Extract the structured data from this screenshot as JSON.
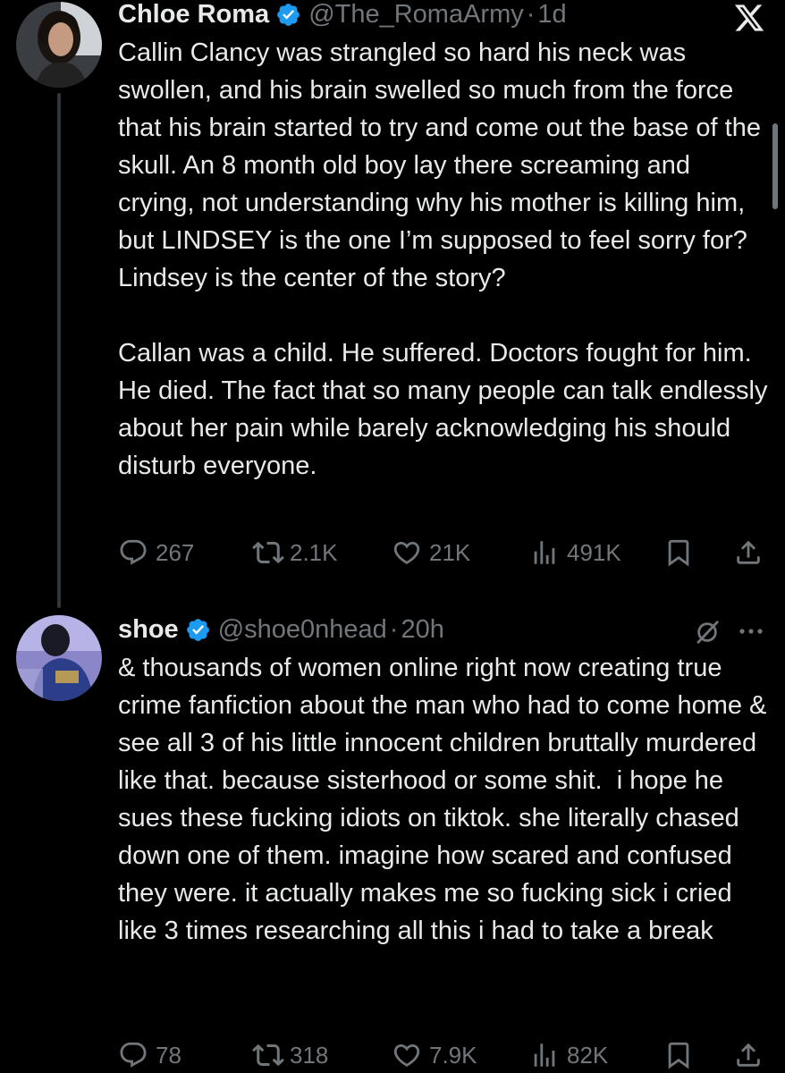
{
  "tweets": [
    {
      "name": "Chloe Roma",
      "handle": "@The_RomaArmy",
      "separator": "·",
      "time": "1d",
      "text": "Callin Clancy was strangled so hard his neck was swollen, and his brain swelled so much from the force that his brain started to try and come out the base of the skull. An 8 month old boy lay there screaming and crying, not understanding why his mother is killing him, but LINDSEY is the one I’m supposed to feel sorry for? Lindsey is the center of the story?\n\nCallan was a child. He suffered. Doctors fought for him. He died. The fact that so many people can talk endlessly about her pain while barely acknowledging his should disturb everyone.",
      "replies": "267",
      "reposts": "2.1K",
      "likes": "21K",
      "views": "491K"
    },
    {
      "name": "shoe",
      "handle": "@shoe0nhead",
      "separator": "·",
      "time": "20h",
      "text": "& thousands of women online right now creating true crime fanfiction about the man who had to come home & see all 3 of his little innocent children bruttally murdered like that. because sisterhood or some shit.  i hope he sues these fucking idiots on tiktok. she literally chased down one of them. imagine how scared and confused they were. it actually makes me so fucking sick i cried like 3 times researching all this i had to take a break",
      "replies": "78",
      "reposts": "318",
      "likes": "7.9K",
      "views": "82K"
    }
  ],
  "icons": {
    "x_logo": "x-logo-icon",
    "grok": "grok-icon",
    "more": "more-icon",
    "verified_color": "#1d9bf0"
  }
}
